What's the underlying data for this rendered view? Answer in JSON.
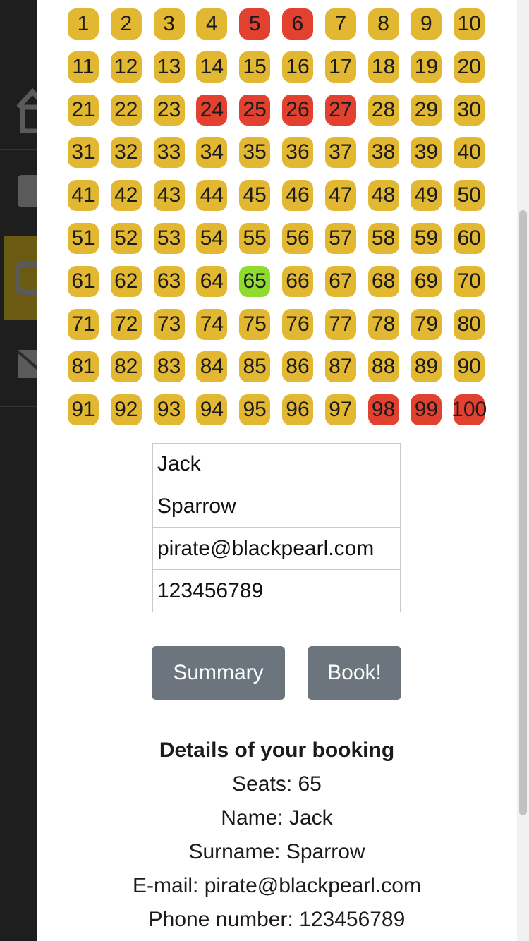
{
  "nav": {
    "items": [
      {
        "icon": "home-icon"
      },
      {
        "icon": "square-icon"
      },
      {
        "icon": "ticket-icon"
      },
      {
        "icon": "mail-icon"
      }
    ]
  },
  "seats": {
    "total": 100,
    "taken": [
      5,
      6,
      24,
      25,
      26,
      27,
      98,
      99,
      100
    ],
    "selected": [
      65
    ],
    "colors": {
      "available": "#e2b832",
      "taken": "#e2412f",
      "selected": "#8fdc2e"
    }
  },
  "form": {
    "first_name": "Jack",
    "last_name": "Sparrow",
    "email": "pirate@blackpearl.com",
    "phone": "123456789"
  },
  "buttons": {
    "summary_label": "Summary",
    "book_label": "Book!"
  },
  "details": {
    "heading": "Details of your booking",
    "seats": "Seats: 65",
    "name": "Name: Jack",
    "surname": "Surname: Sparrow",
    "email": "E-mail: pirate@blackpearl.com",
    "phone": "Phone number: 123456789"
  }
}
